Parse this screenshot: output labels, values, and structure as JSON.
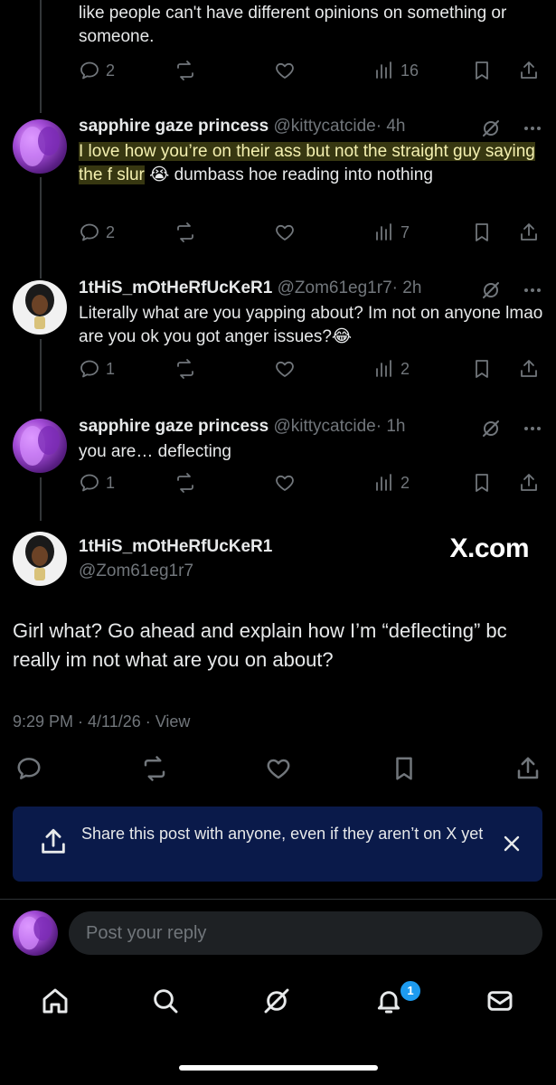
{
  "thread": {
    "prev_text": "like people can't have different opinions on something or someone.",
    "prev_stats": {
      "replies": "2",
      "views": "16"
    }
  },
  "replies": [
    {
      "name": "sapphire gaze princess",
      "handle": "@kittycatcide",
      "time": "· 4h",
      "text_highlight": "I love how you’re on their ass but not the straight guy saying the f slur",
      "emoji": "😭",
      "text_rest": " dumbass hoe reading into nothing",
      "replies": "2",
      "views": "7"
    },
    {
      "name": "1tHiS_mOtHeRfUcKeR1",
      "handle": "@Zom61eg1r7",
      "time": "· 2h",
      "text": "Literally what are you yapping about? Im not on anyone lmao are you ok you got anger issues?",
      "emoji": "😂",
      "replies": "1",
      "views": "2"
    },
    {
      "name": "sapphire gaze princess",
      "handle": "@kittycatcide",
      "time": "· 1h",
      "text": "you are… deflecting",
      "replies": "1",
      "views": "2"
    }
  ],
  "main_post": {
    "name": "1tHiS_mOtHeRfUcKeR1",
    "handle": "@Zom61eg1r7",
    "watermark": "X.com",
    "text": "Girl what? Go ahead and explain how I’m “deflecting” bc really im not what are you on about?",
    "meta": "9:29 PM · 4/11/26 · View"
  },
  "toast": {
    "text": "Share this post with anyone, even if they aren’t on X yet"
  },
  "reply_box": {
    "placeholder": "Post your reply"
  },
  "tabbar": {
    "notifications_badge": "1"
  },
  "colors": {
    "accent": "#1d9bf0",
    "muted": "#71767b",
    "toast_bg": "#0a1a4a"
  }
}
